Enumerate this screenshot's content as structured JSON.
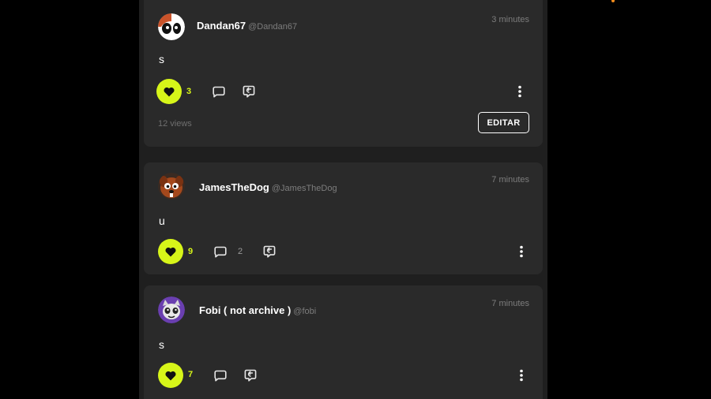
{
  "posts": [
    {
      "username": "Dandan67",
      "handle": "@Dandan67",
      "time": "3 minutes",
      "text": "s",
      "likes": "3",
      "comments": "",
      "views": "12 views",
      "edit_label": "EDITAR"
    },
    {
      "username": "JamesTheDog",
      "handle": "@JamesTheDog",
      "time": "7 minutes",
      "text": "u",
      "likes": "9",
      "comments": "2"
    },
    {
      "username": "Fobi ( not archive )",
      "handle": "@fobi",
      "time": "7 minutes",
      "text": "s",
      "likes": "7",
      "comments": ""
    }
  ],
  "icons": {
    "like": "heart-icon",
    "comment": "comment-icon",
    "share": "reply-icon",
    "more": "more-vertical-icon"
  },
  "colors": {
    "accent": "#d7f519",
    "card": "#2a2a2a",
    "feed_bg": "#1f1f1f"
  }
}
